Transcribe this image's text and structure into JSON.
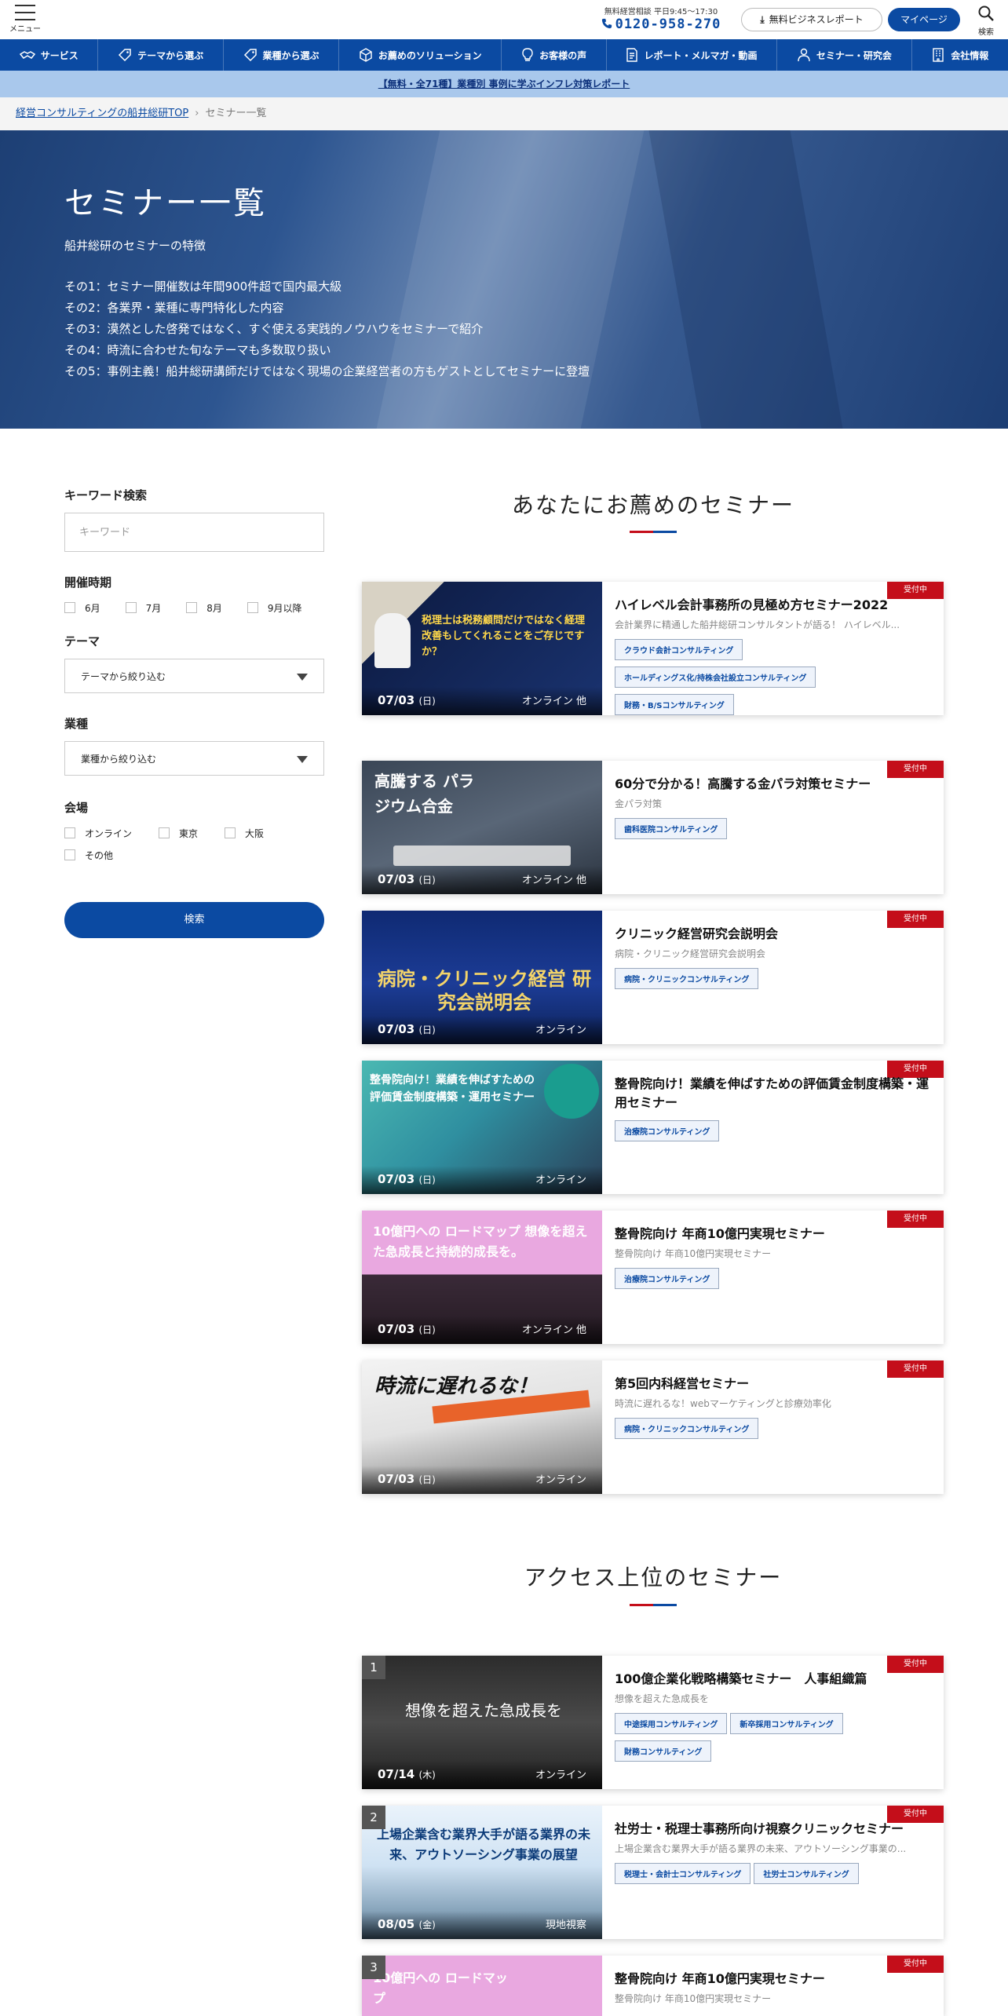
{
  "header": {
    "menu_label": "メニュー",
    "contact_hours": "無料経営相談 平日9:45〜17:30",
    "phone": "0120-958-270",
    "report_button": "無料ビジネスレポート",
    "mypage_button": "マイページ",
    "search_label": "検索"
  },
  "nav": [
    {
      "icon": "handshake-icon",
      "label": "サービス"
    },
    {
      "icon": "tag-icon",
      "label": "テーマから選ぶ"
    },
    {
      "icon": "tag-icon",
      "label": "業種から選ぶ"
    },
    {
      "icon": "cube-icon",
      "label": "お薦めのソリューション"
    },
    {
      "icon": "lightbulb-icon",
      "label": "お客様の声"
    },
    {
      "icon": "document-icon",
      "label": "レポート・メルマガ・動画"
    },
    {
      "icon": "person-icon",
      "label": "セミナー・研究会"
    },
    {
      "icon": "building-icon",
      "label": "会社情報"
    }
  ],
  "promo": "【無料・全71種】業種別 事例に学ぶインフレ対策レポート",
  "breadcrumb": {
    "home": "経営コンサルティングの船井総研TOP",
    "current": "セミナー一覧"
  },
  "hero": {
    "title": "セミナー一覧",
    "subtitle": "船井総研のセミナーの特徴",
    "points": [
      "その1：セミナー開催数は年間900件超で国内最大級",
      "その2：各業界・業種に専門特化した内容",
      "その3：漠然とした啓発ではなく、すぐ使える実践的ノウハウをセミナーで紹介",
      "その4：時流に合わせた旬なテーマも多数取り扱い",
      "その5：事例主義！船井総研講師だけではなく現場の企業経営者の方もゲストとしてセミナーに登壇"
    ]
  },
  "sidebar": {
    "keyword_heading": "キーワード検索",
    "keyword_placeholder": "キーワード",
    "period_heading": "開催時期",
    "periods": [
      "6月",
      "7月",
      "8月",
      "9月以降"
    ],
    "theme_heading": "テーマ",
    "theme_select": "テーマから絞り込む",
    "industry_heading": "業種",
    "industry_select": "業種から絞り込む",
    "venue_heading": "会場",
    "venues": [
      "オンライン",
      "東京",
      "大阪",
      "その他"
    ],
    "search_button": "検索"
  },
  "recommended": {
    "title": "あなたにお薦めのセミナー",
    "items": [
      {
        "status": "受付中",
        "title": "ハイレベル会計事務所の見極め方セミナー2022",
        "desc": "会計業界に精通した船井総研コンサルタントが語る！ ハイレベル...",
        "tags": [
          "クラウド会計コンサルティング",
          "ホールディングス化/持株会社設立コンサルティング",
          "財務・B/Sコンサルティング"
        ],
        "date": "07/03",
        "dow": "(日)",
        "place": "オンライン 他",
        "thumb_text": "税理士は税務顧問だけではなく経理改善もしてくれることをご存じですか？"
      },
      {
        "status": "受付中",
        "title": "60分で分かる！高騰する金パラ対策セミナー",
        "desc": "金パラ対策",
        "tags": [
          "歯科医院コンサルティング"
        ],
        "date": "07/03",
        "dow": "(日)",
        "place": "オンライン 他",
        "thumb_text": "高騰する パラジウム合金"
      },
      {
        "status": "受付中",
        "title": "クリニック経営研究会説明会",
        "desc": "病院・クリニック経営研究会説明会",
        "tags": [
          "病院・クリニックコンサルティング"
        ],
        "date": "07/03",
        "dow": "(日)",
        "place": "オンライン",
        "thumb_text": "病院・クリニック経営 研究会説明会"
      },
      {
        "status": "受付中",
        "title": "整骨院向け！業績を伸ばすための評価賃金制度構築・運用セミナー",
        "desc": "",
        "tags": [
          "治療院コンサルティング"
        ],
        "date": "07/03",
        "dow": "(日)",
        "place": "オンライン",
        "thumb_text": "整骨院向け！業績を伸ばすための評価賃金制度構築・運用セミナー"
      },
      {
        "status": "受付中",
        "title": "整骨院向け 年商10億円実現セミナー",
        "desc": "整骨院向け 年商10億円実現セミナー",
        "tags": [
          "治療院コンサルティング"
        ],
        "date": "07/03",
        "dow": "(日)",
        "place": "オンライン 他",
        "thumb_text": "10億円への ロードマップ 想像を超えた急成長と持続的成長を。"
      },
      {
        "status": "受付中",
        "title": "第5回内科経営セミナー",
        "desc": "時流に遅れるな！webマーケティングと診療効率化",
        "tags": [
          "病院・クリニックコンサルティング"
        ],
        "date": "07/03",
        "dow": "(日)",
        "place": "オンライン",
        "thumb_text": "時流に遅れるな！"
      }
    ]
  },
  "access": {
    "title": "アクセス上位のセミナー",
    "items": [
      {
        "rank": "1",
        "status": "受付中",
        "title": "100億企業化戦略構築セミナー　人事組織篇",
        "desc": "想像を超えた急成長を",
        "tags": [
          "中途採用コンサルティング",
          "新卒採用コンサルティング",
          "財務コンサルティング"
        ],
        "date": "07/14",
        "dow": "(木)",
        "place": "オンライン",
        "thumb_text": "想像を超えた急成長を"
      },
      {
        "rank": "2",
        "status": "受付中",
        "title": "社労士・税理士事務所向け視察クリニックセミナー",
        "desc": "上場企業含む業界大手が語る業界の未来、アウトソーシング事業の...",
        "tags": [
          "税理士・会計士コンサルティング",
          "社労士コンサルティング"
        ],
        "date": "08/05",
        "dow": "(金)",
        "place": "現地視察",
        "thumb_text": "上場企業含む業界大手が語る業界の未来、アウトソーシング事業の展望"
      },
      {
        "rank": "3",
        "status": "受付中",
        "title": "整骨院向け 年商10億円実現セミナー",
        "desc": "整骨院向け 年商10億円実現セミナー",
        "tags": [],
        "date": "",
        "dow": "",
        "place": "",
        "thumb_text": "10億円への ロードマップ"
      }
    ]
  },
  "colors": {
    "brand_blue": "#0b4aa2",
    "status_red": "#c40e1a",
    "promo_bg": "#a9c8ec"
  }
}
